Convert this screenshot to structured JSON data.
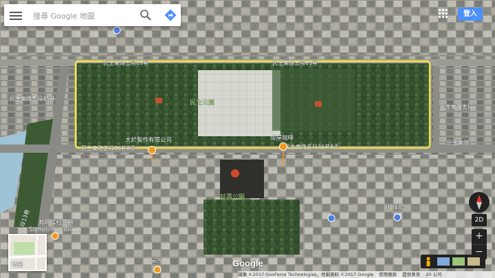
{
  "search": {
    "placeholder": "搜尋 Google 地圖"
  },
  "header": {
    "login_label": "登入"
  },
  "places": {
    "park_minsheng": "民生公園",
    "park_yanshou": "延壽公園",
    "company": "大於製作有限公司",
    "cafe_huwu": "虎屋咖啡",
    "cafe_right": "咖啡廳",
    "shop_beans": "有時候紅豆餅",
    "shop_beans_en": "Sometimes Beans",
    "store_bottom": "福店"
  },
  "streets": {
    "top_road": "民生東路五段69巷",
    "top_road_right": "民生東路五段69巷",
    "bottom_road": "民生東路五段36巷8弄",
    "bottom_road_right": "民生東路五段36巷8弄",
    "left_road": "民生東路五段45巷",
    "right_road_1": "民生東路五段",
    "right_road_2": "民生東路",
    "vertical_road": "五段13巷"
  },
  "controls": {
    "mode_label": "2D",
    "zoom_in": "+",
    "zoom_out": "−",
    "earth_thumb_label": "地圖"
  },
  "logo": "Google",
  "attribution": {
    "imagery": "圖像 ©2017 GooFerce Technologies，地圖資料 ©2017 Google",
    "terms": "使用條款",
    "feedback": "提供意見",
    "scale": "20 公尺"
  },
  "colors": {
    "highlight": "#f2e24a",
    "login": "#4d90fe",
    "pin_orange": "#f29a1f",
    "pin_blue": "#4f7fdc"
  }
}
